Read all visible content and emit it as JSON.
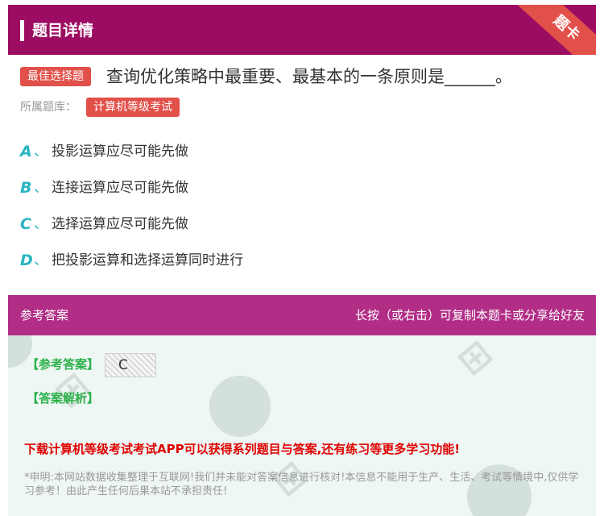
{
  "header": {
    "title": "题目详情",
    "ribbon": "题卡"
  },
  "question": {
    "type_tag": "最佳选择题",
    "text": "查询优化策略中最重要、最基本的一条原则是______。",
    "bank_label": "所属题库：",
    "bank_name": "计算机等级考试"
  },
  "options": [
    {
      "letter": "A",
      "sep": "、",
      "text": "投影运算应尽可能先做"
    },
    {
      "letter": "B",
      "sep": "、",
      "text": "连接运算应尽可能先做"
    },
    {
      "letter": "C",
      "sep": "、",
      "text": "选择运算应尽可能先做"
    },
    {
      "letter": "D",
      "sep": "、",
      "text": "把投影运算和选择运算同时进行"
    }
  ],
  "answer_section": {
    "title": "参考答案",
    "hint": "长按（或右击）可复制本题卡或分享给好友",
    "ref_label": "【参考答案】",
    "ref_value": "C",
    "analysis_label": "【答案解析】",
    "promo": "下载计算机等级考试考试APP可以获得系列题目与答案,还有练习等更多学习功能!",
    "disclaimer": "*申明:本网站数据收集整理于互联网!我们并未能对答案信息进行核对!本信息不能用于生产、生活、考试等情境中,仅供学习参考！由此产生任何后果本站不承担责任!"
  },
  "colors": {
    "header_bg": "#9c0c62",
    "answer_header_bg": "#b12d86",
    "tag_bg": "#e2504a",
    "option_letter": "#2ab5c0",
    "answer_label": "#2bb04a",
    "promo": "#e00000"
  }
}
